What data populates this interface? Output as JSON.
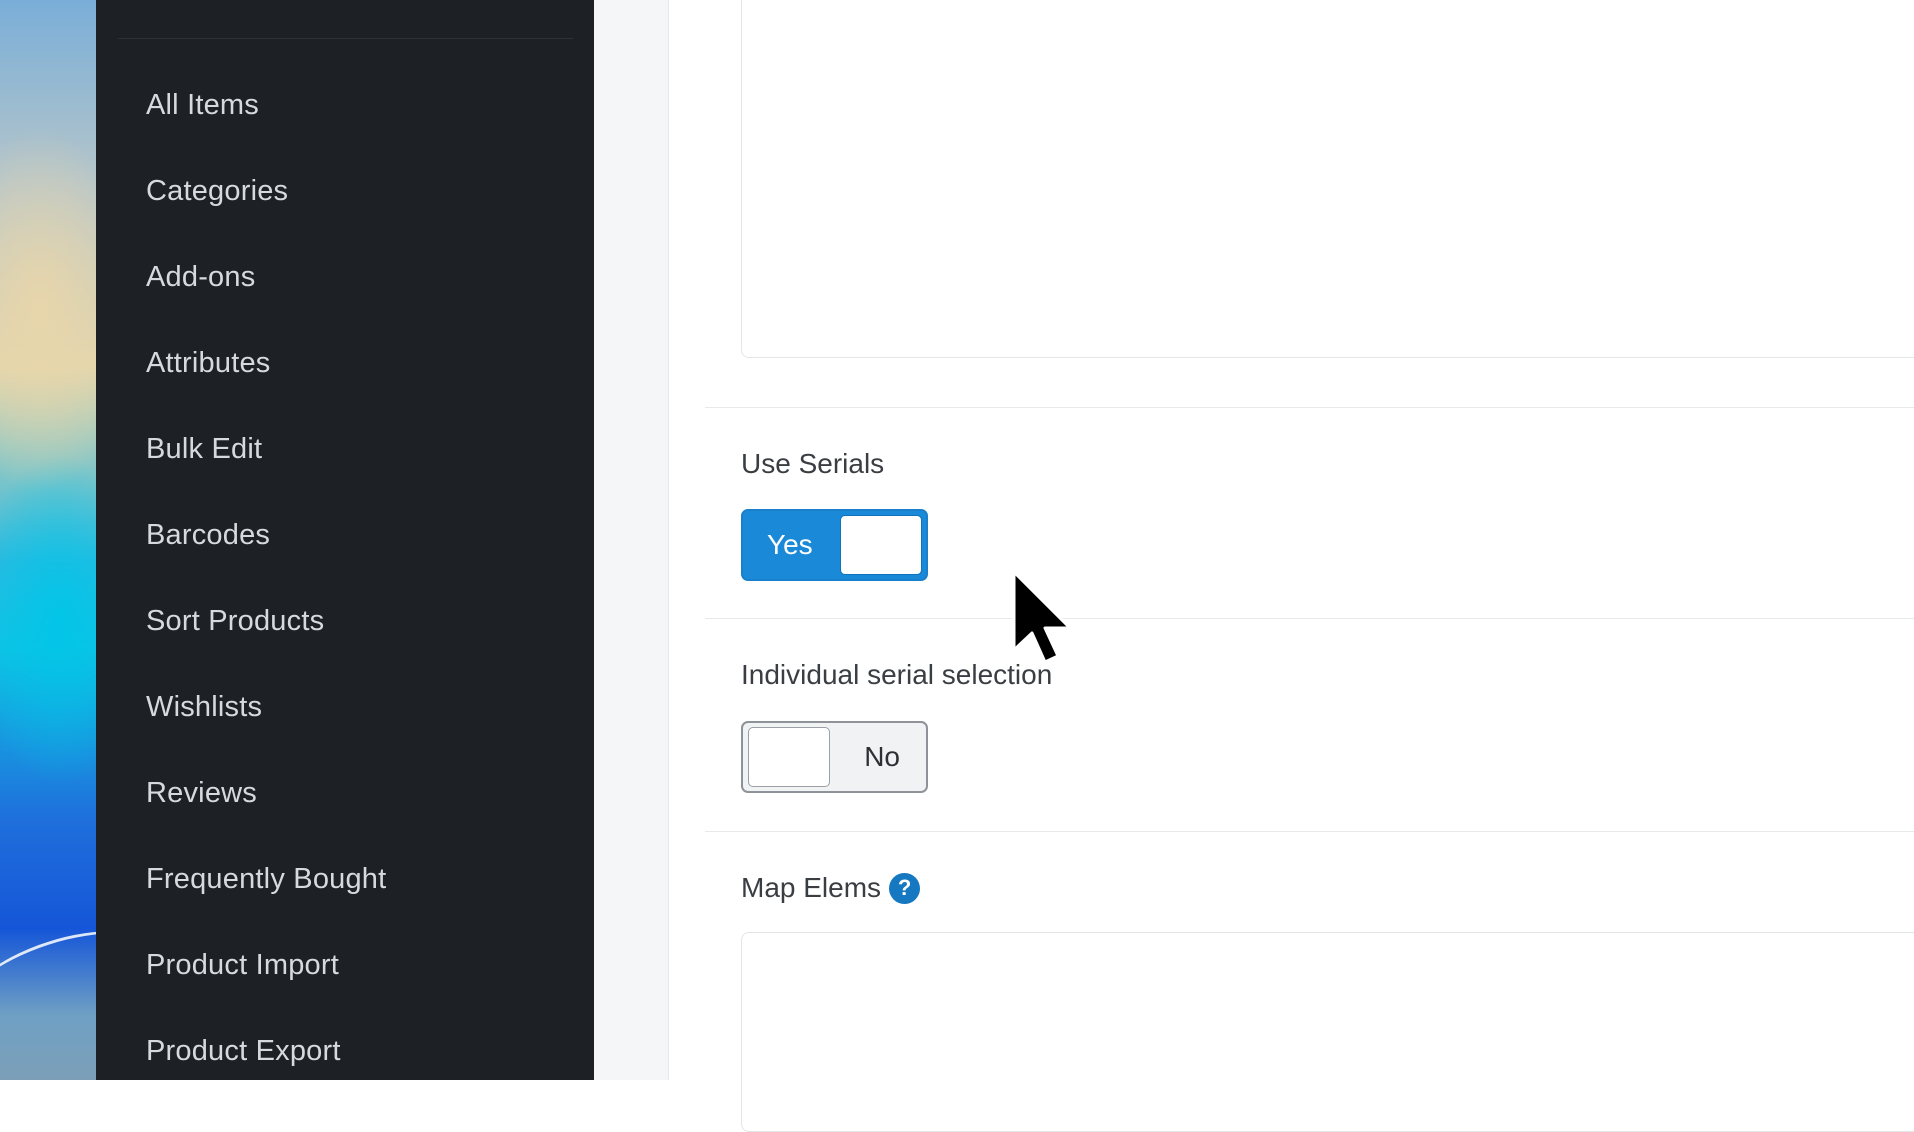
{
  "sidebar": {
    "items": [
      {
        "label": "All Items"
      },
      {
        "label": "Categories"
      },
      {
        "label": "Add-ons"
      },
      {
        "label": "Attributes"
      },
      {
        "label": "Bulk Edit"
      },
      {
        "label": "Barcodes"
      },
      {
        "label": "Sort Products"
      },
      {
        "label": "Wishlists"
      },
      {
        "label": "Reviews"
      },
      {
        "label": "Frequently Bought"
      },
      {
        "label": "Product Import"
      },
      {
        "label": "Product Export"
      }
    ]
  },
  "form": {
    "use_serials": {
      "label": "Use Serials",
      "state_label": "Yes",
      "checked": true
    },
    "individual_serial_selection": {
      "label": "Individual serial selection",
      "state_label": "No",
      "checked": false
    },
    "map_elems": {
      "label": "Map Elems",
      "help_glyph": "?",
      "value": ""
    },
    "description": {
      "value": ""
    }
  },
  "colors": {
    "sidebar_bg": "#1d2125",
    "toggle_on": "#1a8ad8",
    "help_icon": "#1578c0"
  },
  "icons": {
    "help": "question-circle-icon",
    "cursor": "mouse-pointer-icon"
  }
}
